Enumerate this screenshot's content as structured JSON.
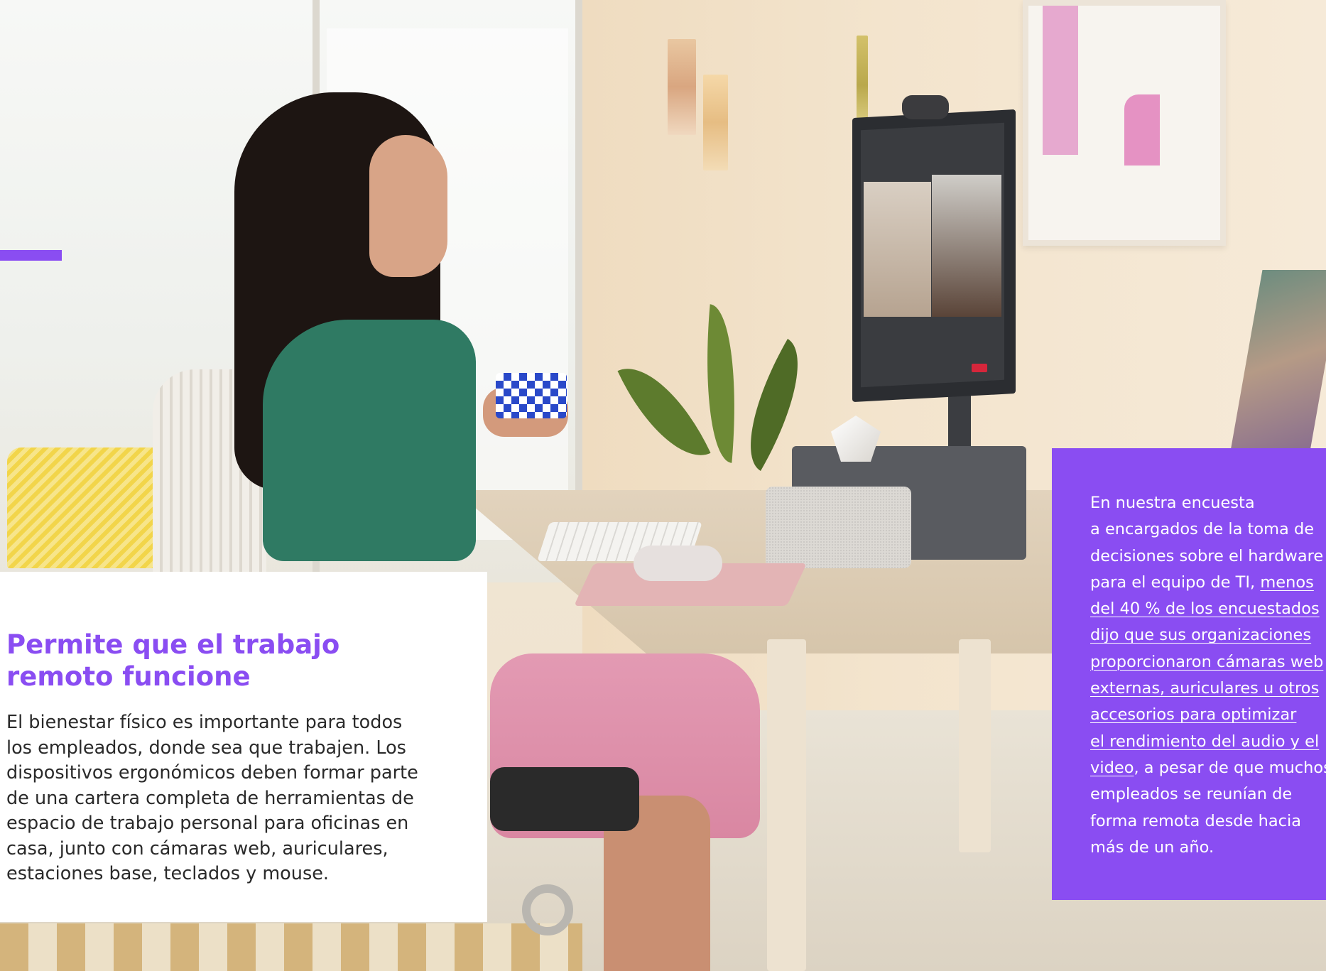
{
  "heading": {
    "line1": "Permite que el trabajo",
    "line2": "remoto funcione"
  },
  "body_lines": [
    "El bienestar físico es importante para todos",
    "los empleados, donde sea que trabajen. Los",
    "dispositivos ergonómicos deben formar parte",
    "de una cartera completa de herramientas de",
    "espacio de trabajo personal para oficinas en",
    "casa, junto con cámaras web, auriculares,",
    "estaciones base, teclados y mouse."
  ],
  "callout": {
    "line1": "En nuestra encuesta",
    "line2": "a encargados de la toma de",
    "line3": "decisiones sobre el hardware",
    "line4_plain": "para el equipo de TI, ",
    "line4_link": "menos",
    "link_lines": [
      "del 40 % de los encuestados",
      "dijo que sus organizaciones",
      "proporcionaron cámaras web",
      "externas, auriculares u otros",
      "accesorios para optimizar",
      "el rendimiento del audio y el"
    ],
    "line11_link": "video",
    "line11_plain": ", a pesar de que muchos",
    "tail_lines": [
      "empleados se reunían de",
      "forma remota desde hacia",
      "más de un año."
    ]
  },
  "colors": {
    "accent": "#8a4df2",
    "body_text": "#2a2a2a",
    "callout_text": "#ffffff"
  },
  "image": {
    "subject": "woman-smiling-on-video-call-at-home-desk",
    "monitor_call_button": "End Call"
  }
}
